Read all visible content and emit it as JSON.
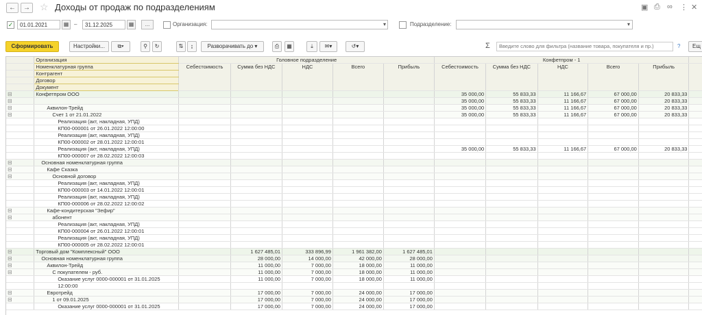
{
  "window": {
    "title": "Доходы от продаж по подразделениям",
    "back_icon": "arrow-left-icon",
    "forward_icon": "arrow-right-icon",
    "favorite_icon": "star-icon",
    "icons": [
      "save-icon",
      "print-icon",
      "link-icon",
      "more-icon",
      "close-icon"
    ]
  },
  "filters": {
    "period_from": "01.01.2021",
    "period_sep": "–",
    "period_to": "31.12.2025",
    "period_btn": "...",
    "organization_label": "Организация:",
    "organization_value": "",
    "division_label": "Подразделение:",
    "division_value": ""
  },
  "toolbar": {
    "generate": "Сформировать",
    "settings": "Настройки...",
    "expand": "Разворачивать до",
    "search_placeholder": "Введите слово для фильтра (название товара, покупателя и пр.)",
    "help": "?",
    "more": "Ещ",
    "sigma": "Σ"
  },
  "report": {
    "header_labels": [
      "Организация",
      "Номенклатурная группа",
      "Контрагент",
      "Договор",
      "Документ"
    ],
    "group1": "Головное подразделение",
    "group2": "Конфетпром - 1",
    "columns": [
      "Себестоимость",
      "Сумма без НДС",
      "НДС",
      "Всего",
      "Прибыль"
    ],
    "rows": [
      {
        "level": "g1",
        "indent": "ind0",
        "label": "Конфетпром ООО",
        "v": [
          "",
          "",
          "",
          "",
          "",
          "35 000,00",
          "55 833,33",
          "11 166,67",
          "67 000,00",
          "20 833,33"
        ]
      },
      {
        "level": "g2",
        "indent": "ind1",
        "label": "",
        "v": [
          "",
          "",
          "",
          "",
          "",
          "35 000,00",
          "55 833,33",
          "11 166,67",
          "67 000,00",
          "20 833,33"
        ]
      },
      {
        "level": "g3",
        "indent": "ind2",
        "label": "Аквилон-Трейд",
        "v": [
          "",
          "",
          "",
          "",
          "",
          "35 000,00",
          "55 833,33",
          "11 166,67",
          "67 000,00",
          "20 833,33"
        ]
      },
      {
        "level": "g3",
        "indent": "ind3",
        "label": "Счет 1 от 21.01.2022",
        "v": [
          "",
          "",
          "",
          "",
          "",
          "35 000,00",
          "55 833,33",
          "11 166,67",
          "67 000,00",
          "20 833,33"
        ]
      },
      {
        "level": "doc",
        "indent": "ind4",
        "label": "Реализация (акт, накладная, УПД)",
        "v": [
          "",
          "",
          "",
          "",
          "",
          "",
          "",
          "",
          "",
          ""
        ]
      },
      {
        "level": "doc",
        "indent": "ind4",
        "label": "КП00-000001 от 26.01.2022 12:00:00",
        "v": [
          "",
          "",
          "",
          "",
          "",
          "",
          "",
          "",
          "",
          ""
        ]
      },
      {
        "level": "doc",
        "indent": "ind4",
        "label": "Реализация (акт, накладная, УПД)",
        "v": [
          "",
          "",
          "",
          "",
          "",
          "",
          "",
          "",
          "",
          ""
        ]
      },
      {
        "level": "doc",
        "indent": "ind4",
        "label": "КП00-000002 от 28.01.2022 12:00:01",
        "v": [
          "",
          "",
          "",
          "",
          "",
          "",
          "",
          "",
          "",
          ""
        ]
      },
      {
        "level": "doc",
        "indent": "ind4",
        "label": "Реализация (акт, накладная, УПД)",
        "v": [
          "",
          "",
          "",
          "",
          "",
          "35 000,00",
          "55 833,33",
          "11 166,67",
          "67 000,00",
          "20 833,33"
        ]
      },
      {
        "level": "doc",
        "indent": "ind4",
        "label": "КП00-000007 от 28.02.2022 12:00:03",
        "v": [
          "",
          "",
          "",
          "",
          "",
          "",
          "",
          "",
          "",
          ""
        ]
      },
      {
        "level": "g2",
        "indent": "ind1",
        "label": "Основная номенклатурная группа",
        "v": [
          "",
          "",
          "",
          "",
          "",
          "",
          "",
          "",
          "",
          ""
        ]
      },
      {
        "level": "g3",
        "indent": "ind2",
        "label": "Кафе Сказка",
        "v": [
          "",
          "",
          "",
          "",
          "",
          "",
          "",
          "",
          "",
          ""
        ]
      },
      {
        "level": "g3",
        "indent": "ind3",
        "label": "Основной договор",
        "v": [
          "",
          "",
          "",
          "",
          "",
          "",
          "",
          "",
          "",
          ""
        ]
      },
      {
        "level": "doc",
        "indent": "ind4",
        "label": "Реализация (акт, накладная, УПД)",
        "v": [
          "",
          "",
          "",
          "",
          "",
          "",
          "",
          "",
          "",
          ""
        ]
      },
      {
        "level": "doc",
        "indent": "ind4",
        "label": "КП00-000003 от 14.01.2022 12:00:01",
        "v": [
          "",
          "",
          "",
          "",
          "",
          "",
          "",
          "",
          "",
          ""
        ]
      },
      {
        "level": "doc",
        "indent": "ind4",
        "label": "Реализация (акт, накладная, УПД)",
        "v": [
          "",
          "",
          "",
          "",
          "",
          "",
          "",
          "",
          "",
          ""
        ]
      },
      {
        "level": "doc",
        "indent": "ind4",
        "label": "КП00-000006 от 28.02.2022 12:00:02",
        "v": [
          "",
          "",
          "",
          "",
          "",
          "",
          "",
          "",
          "",
          ""
        ]
      },
      {
        "level": "g3",
        "indent": "ind2",
        "label": "Кафе-кондитерская \"Зефир\"",
        "v": [
          "",
          "",
          "",
          "",
          "",
          "",
          "",
          "",
          "",
          ""
        ]
      },
      {
        "level": "g3",
        "indent": "ind3",
        "label": "абонент",
        "v": [
          "",
          "",
          "",
          "",
          "",
          "",
          "",
          "",
          "",
          ""
        ]
      },
      {
        "level": "doc",
        "indent": "ind4",
        "label": "Реализация (акт, накладная, УПД)",
        "v": [
          "",
          "",
          "",
          "",
          "",
          "",
          "",
          "",
          "",
          ""
        ]
      },
      {
        "level": "doc",
        "indent": "ind4",
        "label": "КП00-000004 от 26.01.2022 12:00:01",
        "v": [
          "",
          "",
          "",
          "",
          "",
          "",
          "",
          "",
          "",
          ""
        ]
      },
      {
        "level": "doc",
        "indent": "ind4",
        "label": "Реализация (акт, накладная, УПД)",
        "v": [
          "",
          "",
          "",
          "",
          "",
          "",
          "",
          "",
          "",
          ""
        ]
      },
      {
        "level": "doc",
        "indent": "ind4",
        "label": "КП00-000005 от 28.02.2022 12:00:01",
        "v": [
          "",
          "",
          "",
          "",
          "",
          "",
          "",
          "",
          "",
          ""
        ]
      },
      {
        "level": "g1",
        "indent": "ind0",
        "label": "Торговый дом \"Комплексный\" ООО",
        "v": [
          "",
          "1 627 485,01",
          "333 896,99",
          "1 961 382,00",
          "1 627 485,01",
          "",
          "",
          "",
          "",
          ""
        ]
      },
      {
        "level": "g2",
        "indent": "ind1",
        "label": "Основная номенклатурная группа",
        "v": [
          "",
          "28 000,00",
          "14 000,00",
          "42 000,00",
          "28 000,00",
          "",
          "",
          "",
          "",
          ""
        ]
      },
      {
        "level": "g3",
        "indent": "ind2",
        "label": "Аквилон-Трейд",
        "v": [
          "",
          "11 000,00",
          "7 000,00",
          "18 000,00",
          "11 000,00",
          "",
          "",
          "",
          "",
          ""
        ]
      },
      {
        "level": "g3",
        "indent": "ind3",
        "label": "С покупателем - руб.",
        "v": [
          "",
          "11 000,00",
          "7 000,00",
          "18 000,00",
          "11 000,00",
          "",
          "",
          "",
          "",
          ""
        ]
      },
      {
        "level": "doc",
        "indent": "ind4",
        "label": "Оказание услуг 0000-000001 от 31.01.2025",
        "v": [
          "",
          "11 000,00",
          "7 000,00",
          "18 000,00",
          "11 000,00",
          "",
          "",
          "",
          "",
          ""
        ]
      },
      {
        "level": "doc",
        "indent": "ind4",
        "label": "12:00:00",
        "v": [
          "",
          "",
          "",
          "",
          "",
          "",
          "",
          "",
          "",
          ""
        ]
      },
      {
        "level": "g3",
        "indent": "ind2",
        "label": "Евротрейд",
        "v": [
          "",
          "17 000,00",
          "7 000,00",
          "24 000,00",
          "17 000,00",
          "",
          "",
          "",
          "",
          ""
        ]
      },
      {
        "level": "g3",
        "indent": "ind3",
        "label": "1 от 09.01.2025",
        "v": [
          "",
          "17 000,00",
          "7 000,00",
          "24 000,00",
          "17 000,00",
          "",
          "",
          "",
          "",
          ""
        ]
      },
      {
        "level": "doc",
        "indent": "ind4",
        "label": "Оказание услуг 0000-000001 от 31.01.2025",
        "v": [
          "",
          "17 000,00",
          "7 000,00",
          "24 000,00",
          "17 000,00",
          "",
          "",
          "",
          "",
          ""
        ]
      }
    ]
  }
}
